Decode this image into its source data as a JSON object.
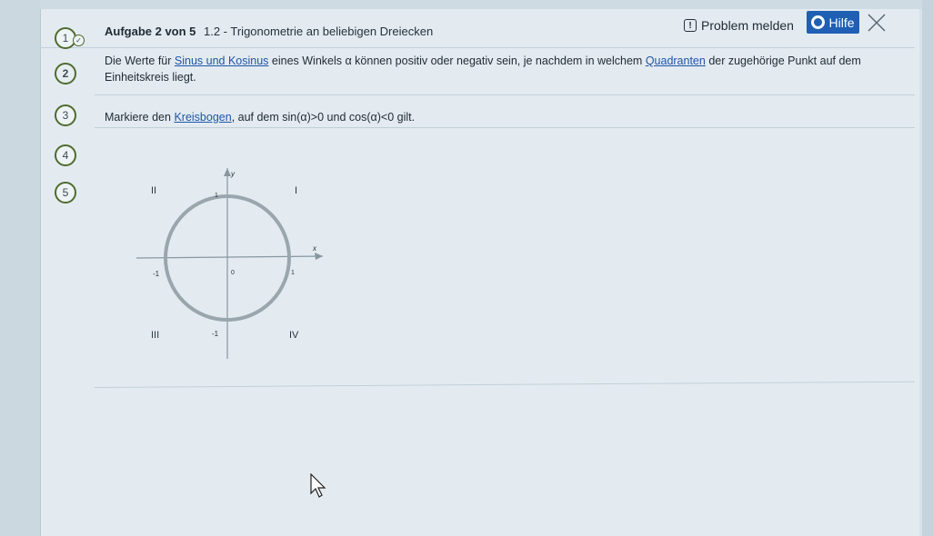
{
  "header": {
    "task_label": "Aufgabe 2 von 5",
    "topic": "1.2 - Trigonometrie an beliebigen Dreiecken",
    "report_label": "Problem melden",
    "report_icon": "exclamation-icon",
    "help_label": "Hilfe",
    "help_icon": "lifebuoy-icon",
    "close_icon": "close-icon"
  },
  "steps": [
    "1",
    "2",
    "3",
    "4",
    "5"
  ],
  "intro": {
    "part1": "Die Werte für ",
    "link1": "Sinus und Kosinus",
    "part2": " eines Winkels α können positiv oder negativ sein, je nachdem in welchem ",
    "link2": "Quadranten",
    "part3": " der zugehörige Punkt auf dem",
    "line2": "Einheitskreis liegt."
  },
  "instruction": {
    "part1": "Markiere den ",
    "link": "Kreisbogen",
    "part2": ", auf dem ",
    "sin_expr": "sin(α)>0",
    "part3": " und ",
    "cos_expr": "cos(α)<0",
    "part4": " gilt."
  },
  "graph": {
    "quadrants": {
      "q1": "I",
      "q2": "II",
      "q3": "III",
      "q4": "IV"
    },
    "axis_x": "x",
    "axis_y": "y",
    "ticks": {
      "x_neg": "-1",
      "origin": "0",
      "x_pos": "1",
      "y_pos": "1",
      "y_neg": "-1"
    }
  },
  "colors": {
    "accent": "#1f5fb4",
    "step_border": "#4f6b2f",
    "link": "#1f55a8"
  }
}
